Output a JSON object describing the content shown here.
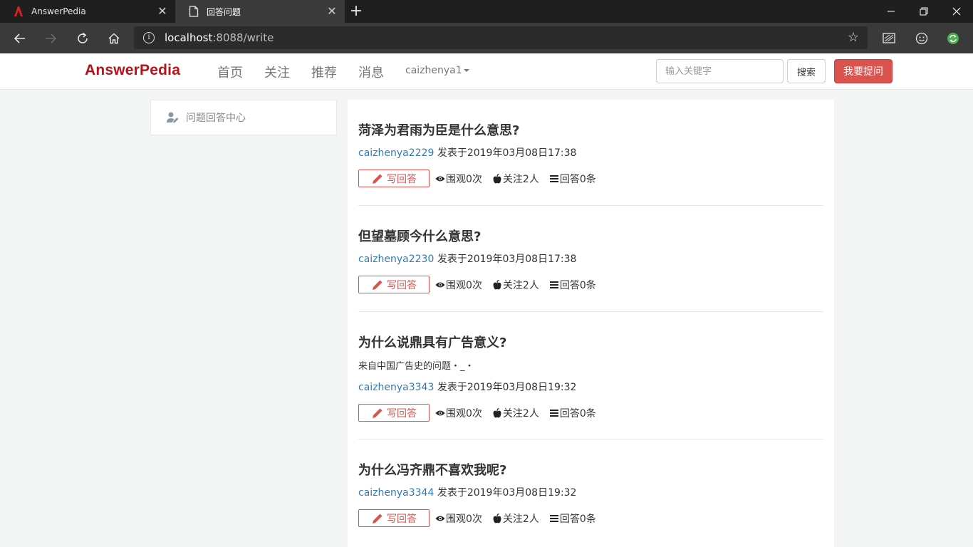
{
  "browser": {
    "tabs": [
      {
        "title": "AnswerPedia",
        "active": false
      },
      {
        "title": "回答问题",
        "active": true
      }
    ],
    "url_host": "localhost",
    "url_rest": ":8088/write"
  },
  "site": {
    "brand": "AnswerPedia",
    "menu": [
      "首页",
      "关注",
      "推荐",
      "消息"
    ],
    "username": "caizhenya1",
    "search_placeholder": "输入关键字",
    "search_button": "搜索",
    "ask_button": "我要提问"
  },
  "sidebar": {
    "label": "问题回答中心"
  },
  "questions": [
    {
      "title": "菏泽为君雨为臣是什么意思?",
      "description": "",
      "author": "caizhenya2229",
      "posted": "发表于2019年03月08日17:38",
      "write_label": "写回答",
      "views": "围观0次",
      "follows": "关注2人",
      "answers": "回答0条"
    },
    {
      "title": "但望墓顾今什么意思?",
      "description": "",
      "author": "caizhenya2230",
      "posted": "发表于2019年03月08日17:38",
      "write_label": "写回答",
      "views": "围观0次",
      "follows": "关注2人",
      "answers": "回答0条"
    },
    {
      "title": "为什么说鼎具有广告意义?",
      "description": "来自中国广告史的问题・_・",
      "author": "caizhenya3343",
      "posted": "发表于2019年03月08日19:32",
      "write_label": "写回答",
      "views": "围观0次",
      "follows": "关注2人",
      "answers": "回答0条"
    },
    {
      "title": "为什么冯齐鼎不喜欢我呢?",
      "description": "",
      "author": "caizhenya3344",
      "posted": "发表于2019年03月08日19:32",
      "write_label": "写回答",
      "views": "围观0次",
      "follows": "关注2人",
      "answers": "回答0条"
    }
  ],
  "colors": {
    "brand": "#b4111b",
    "accent": "#d9534f",
    "link": "#337ab7"
  }
}
